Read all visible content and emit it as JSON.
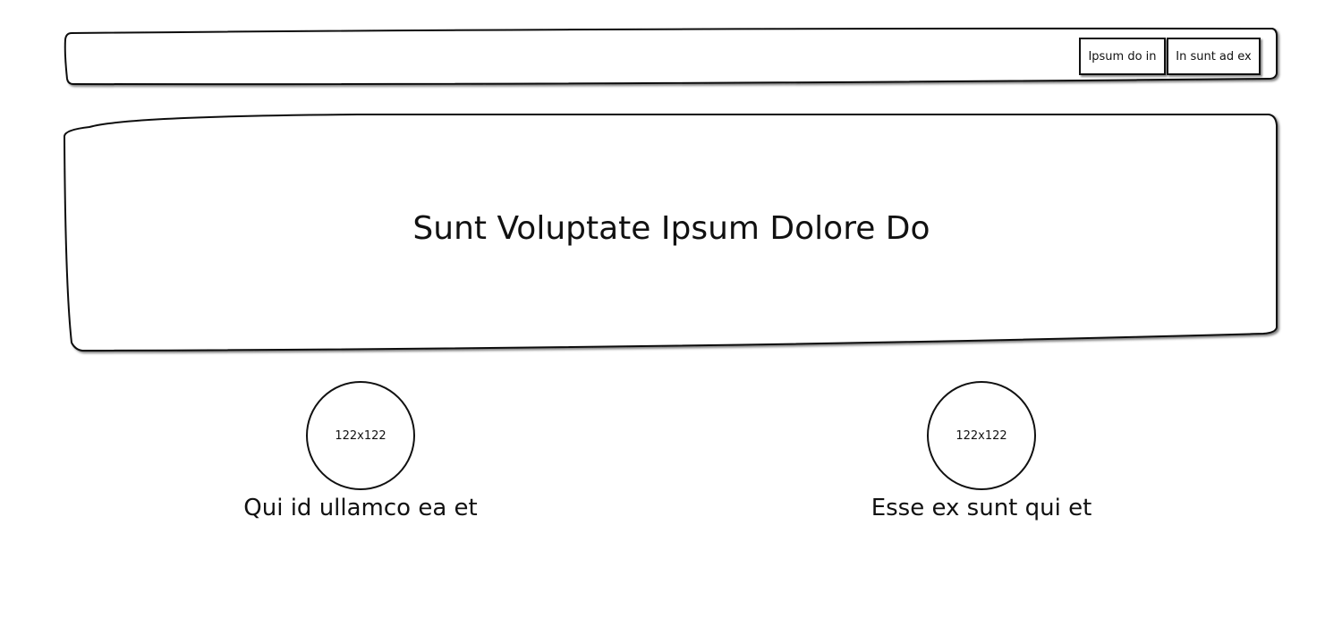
{
  "nav": {
    "buttons": [
      {
        "label": "Ipsum do in"
      },
      {
        "label": "In sunt ad ex"
      }
    ]
  },
  "hero": {
    "title": "Sunt Voluptate Ipsum Dolore Do"
  },
  "features": [
    {
      "image_label": "122x122",
      "caption": "Qui id ullamco ea et"
    },
    {
      "image_label": "122x122",
      "caption": "Esse ex sunt qui et"
    }
  ]
}
